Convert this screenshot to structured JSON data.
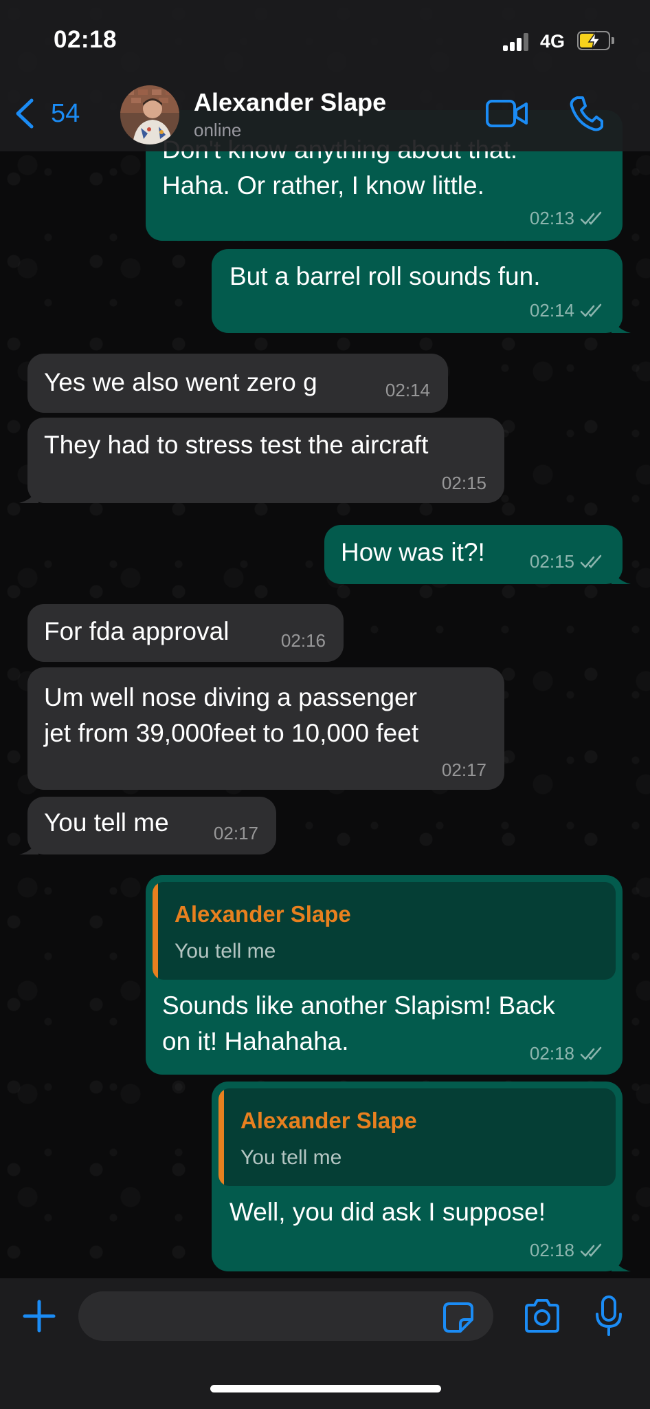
{
  "status_bar": {
    "time": "02:18",
    "network": "4G"
  },
  "header": {
    "back_count": "54",
    "contact_name": "Alexander Slape",
    "contact_status": "online"
  },
  "messages": [
    {
      "direction": "out",
      "text_lines": [
        "Don't know anything about that.",
        "Haha. Or rather, I know little."
      ],
      "time": "02:13",
      "read": true
    },
    {
      "direction": "out",
      "text_lines": [
        "But a barrel roll sounds fun."
      ],
      "time": "02:14",
      "read": true
    },
    {
      "direction": "in",
      "text_lines": [
        "Yes we also went zero g"
      ],
      "time": "02:14"
    },
    {
      "direction": "in",
      "text_lines": [
        "They had to stress test the aircraft"
      ],
      "time": "02:15"
    },
    {
      "direction": "out",
      "text_lines": [
        "How was it?!"
      ],
      "time": "02:15",
      "read": true
    },
    {
      "direction": "in",
      "text_lines": [
        "For fda approval"
      ],
      "time": "02:16"
    },
    {
      "direction": "in",
      "text_lines": [
        "Um well nose diving a passenger",
        "jet from 39,000feet to 10,000 feet"
      ],
      "time": "02:17"
    },
    {
      "direction": "in",
      "text_lines": [
        "You tell me"
      ],
      "time": "02:17"
    },
    {
      "direction": "out",
      "quote": {
        "author": "Alexander Slape",
        "text": "You tell me"
      },
      "text_lines": [
        "Sounds like another Slapism! Back",
        "on it! Hahahaha."
      ],
      "time": "02:18",
      "read": true
    },
    {
      "direction": "out",
      "quote": {
        "author": "Alexander Slape",
        "text": "You tell me"
      },
      "text_lines": [
        "Well, you did ask I suppose!"
      ],
      "time": "02:18",
      "read": true
    }
  ],
  "composer": {
    "placeholder": ""
  },
  "icons": [
    "back-chevron-icon",
    "video-call-icon",
    "phone-icon",
    "plus-icon",
    "sticker-icon",
    "camera-icon",
    "microphone-icon",
    "read-ticks-icon"
  ],
  "colors": {
    "outgoing_bubble": "#035b4d",
    "incoming_bubble": "#2e2e30",
    "accent_blue": "#1b8cf5",
    "quote_author": "#e8801f",
    "battery": "#f7d21c"
  }
}
